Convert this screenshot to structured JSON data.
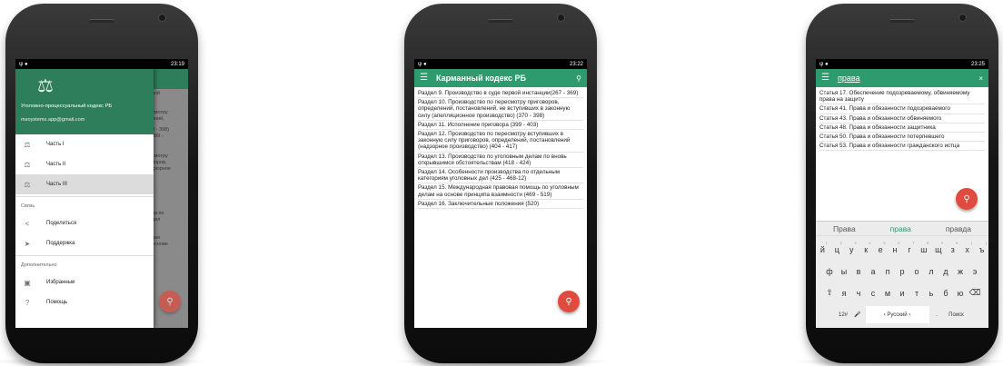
{
  "phone1": {
    "status_time": "23:19",
    "drawer": {
      "title": "Уголовно-процессуальный кодекс РБ",
      "email": "msoystems.app@gmail.com",
      "items": [
        {
          "label": "Часть I",
          "icon": "scales-small-icon"
        },
        {
          "label": "Часть II",
          "icon": "scales-small-icon"
        },
        {
          "label": "Часть III",
          "icon": "scales-small-icon",
          "selected": true
        }
      ],
      "section_contact": "Связь",
      "contact_items": [
        {
          "label": "Поделиться",
          "icon": "share-icon"
        },
        {
          "label": "Поддержка",
          "icon": "send-icon"
        }
      ],
      "section_more": "Дополнительно",
      "more_items": [
        {
          "label": "Избранные",
          "icon": "bookmark-icon"
        },
        {
          "label": "Помощь",
          "icon": "help-icon"
        }
      ]
    },
    "underlay_text": [
      "вой",
      "смотру",
      "ений,",
      "0 - 398)",
      "399 -",
      "смотру",
      "воров,",
      "дзорное",
      "ва по",
      "дел",
      "вая",
      "основе"
    ]
  },
  "phone2": {
    "status_time": "23:22",
    "app_title": "Карманный кодекс РБ",
    "rows": [
      "Раздел 9. Производство в суде первой инстанции(267 - 369)",
      "Раздел 10. Производство по пересмотру приговоров, определений, постановлений, не вступивших в законную силу (апелляционное производство) (370 - 398)",
      "Раздел 11. Исполнение приговора (399 - 403)",
      "Раздел 12. Производство по пересмотру вступивших в законную силу приговоров, определений, постановлений (надзорное производство) (404 - 417)",
      "Раздел 13. Производство по уголовным делам по вновь открывшимся обстоятельствам (418 - 424)",
      "Раздел 14. Особенности производства по отдельным категориям уголовных дел (425 - 468-12)",
      "Раздел 15. Международная правовая помощь по уголовным делам на основе принципа взаимности (469 - 519)",
      "Раздел 16. Заключительные положения (520)"
    ]
  },
  "phone3": {
    "status_time": "23:25",
    "search_value": "права",
    "rows": [
      "Статья 17. Обеспечение подозреваемому, обвиняемому права на защиту",
      "Статья 41. Права и обязанности подозреваемого",
      "Статья 43. Права и обязанности обвиняемого",
      "Статья 48. Права и обязанности защитника",
      "Статья 50. Права и обязанности потерпевшего",
      "Статья 53. Права и обязанности гражданского истца"
    ],
    "keyboard": {
      "suggestions": [
        "Права",
        "права",
        "правда"
      ],
      "row1": [
        "й",
        "ц",
        "у",
        "к",
        "е",
        "н",
        "г",
        "ш",
        "щ",
        "з",
        "х",
        "ъ"
      ],
      "row1_hints": [
        "1",
        "2",
        "3",
        "4",
        "5",
        "6",
        "7",
        "8",
        "9",
        "0",
        "(",
        ")"
      ],
      "row2": [
        "ф",
        "ы",
        "в",
        "а",
        "п",
        "р",
        "о",
        "л",
        "д",
        "ж",
        "э"
      ],
      "row3": [
        "я",
        "ч",
        "с",
        "м",
        "и",
        "т",
        "ь",
        "б",
        "ю"
      ],
      "sym_key": "12#",
      "space_label": "‹ Русский ›",
      "search_key": "Поиск"
    }
  },
  "colors": {
    "primary": "#2e9b6f",
    "primary_dark": "#2e7d5b",
    "fab": "#e04b3f"
  }
}
